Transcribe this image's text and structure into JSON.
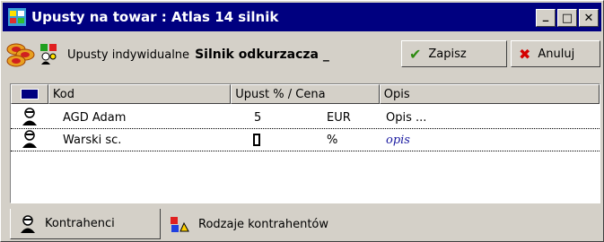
{
  "window": {
    "title": "Upusty na towar : Atlas 14 silnik",
    "minimize_glyph": "_",
    "maximize_glyph": "□",
    "close_glyph": "✕"
  },
  "toolbar": {
    "label_individual": "Upusty indywidualne",
    "product_name": "Silnik odkurzacza _",
    "save_label": "Zapisz",
    "cancel_label": "Anuluj"
  },
  "table": {
    "columns": [
      "Kod",
      "Upust % / Cena",
      "Opis"
    ],
    "rows": [
      {
        "kod": "AGD Adam",
        "upust": "5",
        "unit": "EUR",
        "opis": "Opis ..."
      },
      {
        "kod": "Warski sc.",
        "upust": "",
        "unit": "%",
        "opis": "opis"
      }
    ]
  },
  "tabs": {
    "contractors": "Kontrahenci",
    "contractor_types": "Rodzaje kontrahentów"
  },
  "colors": {
    "titlebar": "#000080",
    "face": "#d4d0c8",
    "save_check": "#2e8b12",
    "cancel_x": "#d40000"
  }
}
